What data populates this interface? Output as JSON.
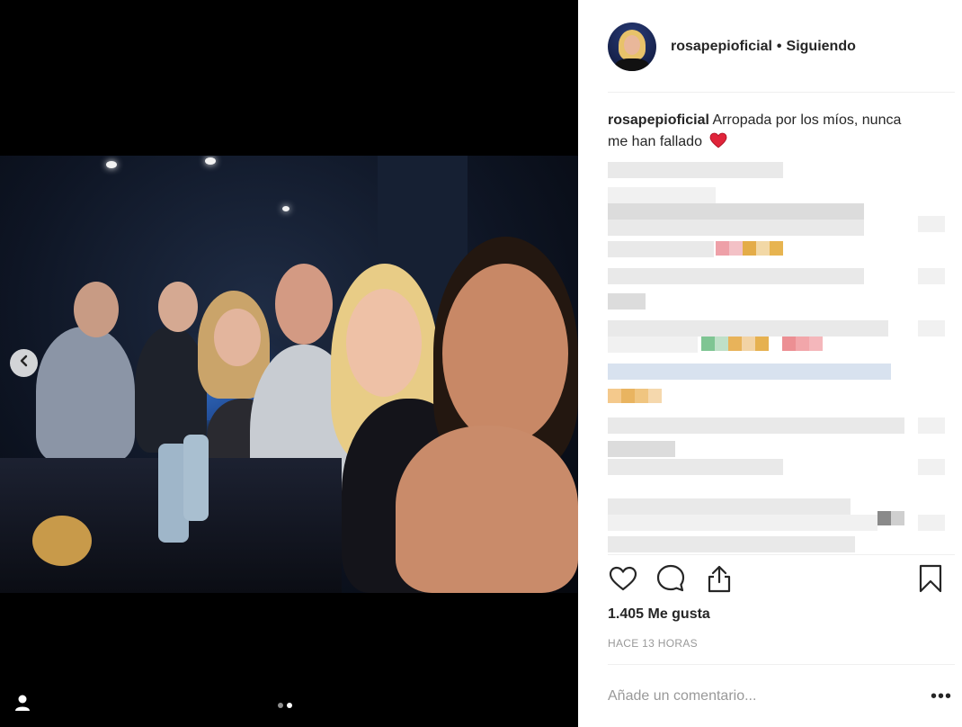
{
  "post": {
    "username": "rosapepioficial",
    "separator": "•",
    "follow_status": "Siguiendo",
    "caption_user": "rosapepioficial",
    "caption_text": "Arropada por los míos, nunca me han fallado",
    "caption_emoji_icon": "red-heart-icon",
    "likes": "1.405 Me gusta",
    "timestamp": "HACE 13 HORAS",
    "comment_placeholder": "Añade un comentario...",
    "more_options_label": "•••"
  },
  "carousel": {
    "slide_count": 2,
    "active_slide": 2
  },
  "icons": {
    "prev": "chevron-left-icon",
    "tagged_people": "user-tag-icon",
    "like": "heart-outline-icon",
    "comment": "comment-bubble-icon",
    "share": "share-upload-icon",
    "save": "bookmark-icon"
  },
  "colors": {
    "text": "#262626",
    "muted": "#999999",
    "divider": "#efefef",
    "media_bg": "#000000",
    "heart_emoji": "#e0243a"
  }
}
